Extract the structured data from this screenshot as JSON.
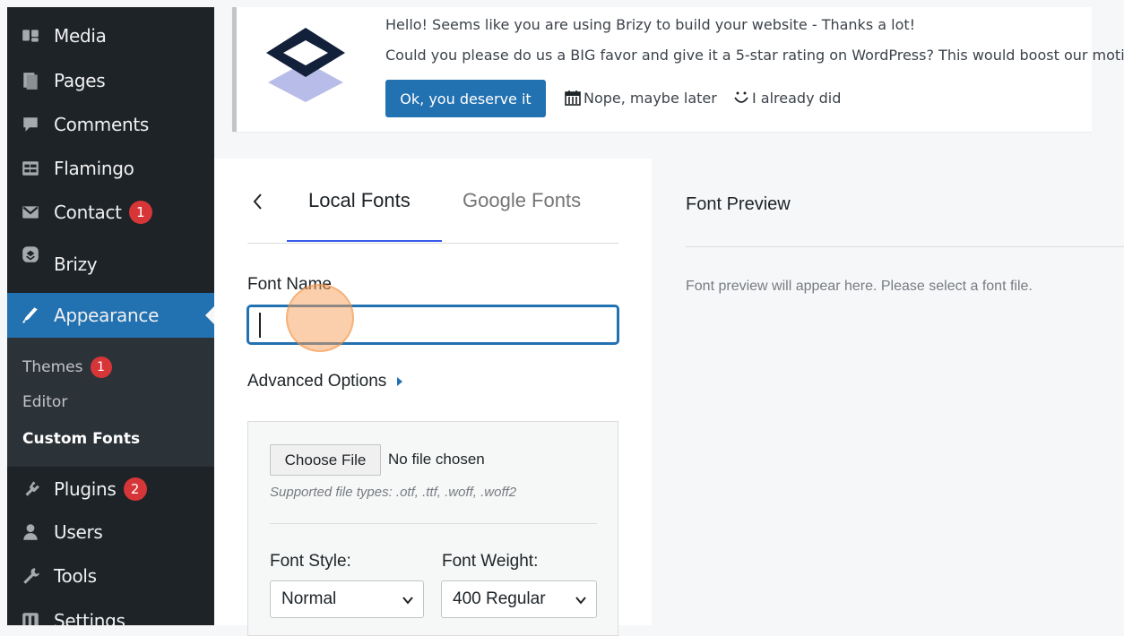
{
  "sidebar": {
    "items": [
      {
        "label": "Media",
        "icon": "media-icon"
      },
      {
        "label": "Pages",
        "icon": "pages-icon"
      },
      {
        "label": "Comments",
        "icon": "comments-icon"
      },
      {
        "label": "Flamingo",
        "icon": "flamingo-icon"
      },
      {
        "label": "Contact",
        "icon": "mail-icon",
        "badge": "1"
      },
      {
        "label": "Brizy",
        "icon": "brizy-icon"
      },
      {
        "label": "Appearance",
        "icon": "brush-icon"
      },
      {
        "label": "Plugins",
        "icon": "plugin-icon",
        "badge": "2"
      },
      {
        "label": "Users",
        "icon": "users-icon"
      },
      {
        "label": "Tools",
        "icon": "wrench-icon"
      },
      {
        "label": "Settings",
        "icon": "settings-icon"
      }
    ],
    "submenu": [
      {
        "label": "Themes",
        "badge": "1"
      },
      {
        "label": "Editor"
      },
      {
        "label": "Custom Fonts"
      }
    ]
  },
  "notice": {
    "line1": "Hello! Seems like you are using Brizy to build your website - Thanks a lot!",
    "line2": "Could you please do us a BIG favor and give it a 5-star rating on WordPress? This would boost our motivation",
    "primary_button": "Ok, you deserve it",
    "later_link": "Nope, maybe later",
    "already_link": "I already did"
  },
  "fonts": {
    "tabs": [
      "Local Fonts",
      "Google Fonts"
    ],
    "font_name_label": "Font Name",
    "font_name_value": "",
    "advanced_options": "Advanced Options",
    "choose_file": "Choose File",
    "no_file": "No file chosen",
    "file_types": "Supported file types: .otf, .ttf, .woff, .woff2",
    "font_style_label": "Font Style:",
    "font_style_value": "Normal",
    "font_weight_label": "Font Weight:",
    "font_weight_value": "400 Regular"
  },
  "preview": {
    "title": "Font Preview",
    "placeholder": "Font preview will appear here. Please select a font file."
  },
  "colors": {
    "sidebar_bg": "#1d2327",
    "accent": "#2271b1",
    "badge": "#d63638"
  }
}
